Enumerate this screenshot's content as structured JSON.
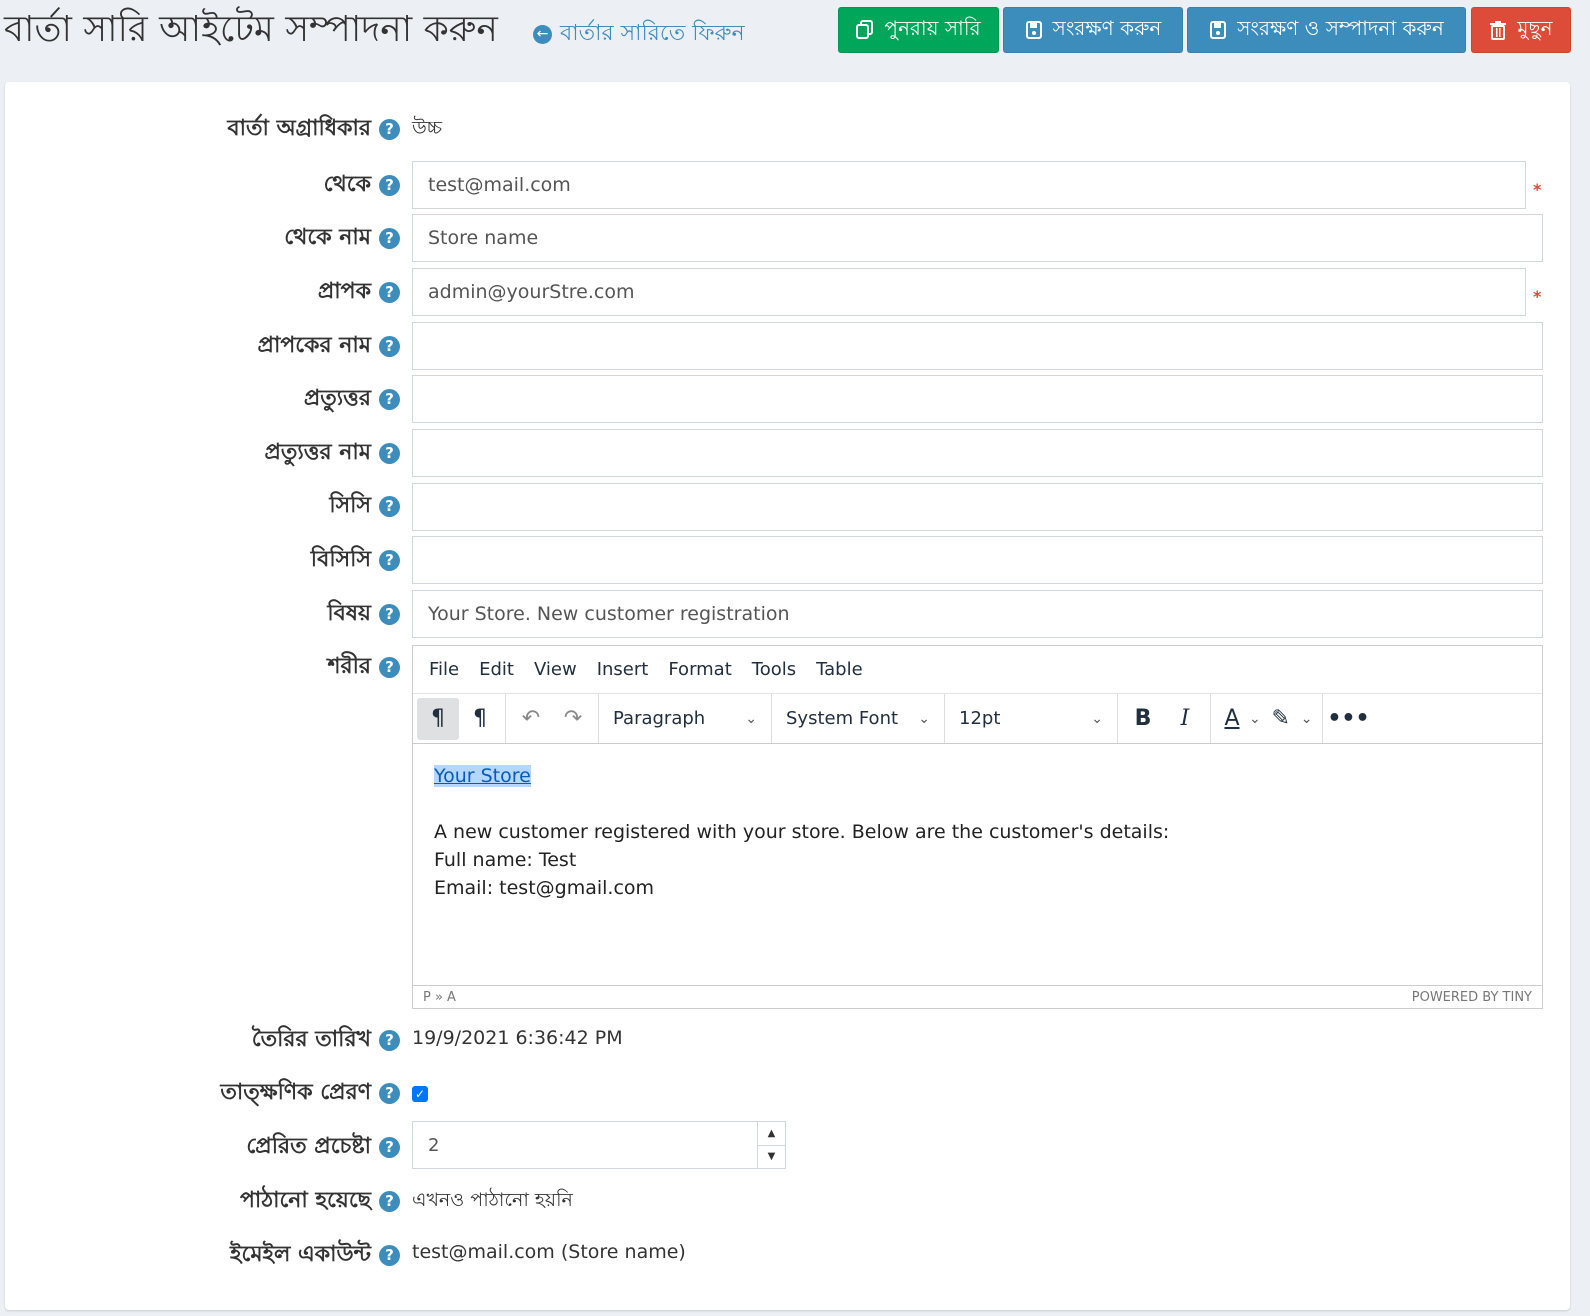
{
  "header": {
    "title": "বার্তা সারি আইটেম সম্পাদনা করুন",
    "back_icon": "arrow-left-circle-icon",
    "back_link": "বার্তার সারিতে ফিরুন",
    "buttons": {
      "requeue": "পুনরায় সারি",
      "save": "সংরক্ষণ করুন",
      "save_continue": "সংরক্ষণ ও সম্পাদনা করুন",
      "delete": "মুছুন"
    }
  },
  "help_glyph": "?",
  "required_mark": "*",
  "fields": {
    "priority": {
      "label": "বার্তা অগ্রাধিকার",
      "value": "উচ্চ"
    },
    "from": {
      "label": "থেকে",
      "value": "test@mail.com"
    },
    "from_name": {
      "label": "থেকে নাম",
      "value": "Store name"
    },
    "to": {
      "label": "প্রাপক",
      "value": "admin@yourStre.com"
    },
    "to_name": {
      "label": "প্রাপকের নাম",
      "value": ""
    },
    "reply_to": {
      "label": "প্রত্যুত্তর",
      "value": ""
    },
    "reply_to_name": {
      "label": "প্রত্যুত্তর নাম",
      "value": ""
    },
    "cc": {
      "label": "সিসি",
      "value": ""
    },
    "bcc": {
      "label": "বিসিসি",
      "value": ""
    },
    "subject": {
      "label": "বিষয়",
      "value": "Your Store. New customer registration"
    },
    "body": {
      "label": "শরীর"
    },
    "created_on": {
      "label": "তৈরির তারিখ",
      "value": "19/9/2021 6:36:42 PM"
    },
    "send_immediately": {
      "label": "তাত্ক্ষণিক প্রেরণ",
      "checked": true
    },
    "sent_tries": {
      "label": "প্রেরিত প্রচেষ্টা",
      "value": "2"
    },
    "sent_on": {
      "label": "পাঠানো হয়েছে",
      "value": "এখনও পাঠানো হয়নি"
    },
    "email_account": {
      "label": "ইমেইল একাউন্ট",
      "value": "test@mail.com (Store name)"
    }
  },
  "editor": {
    "menu": [
      "File",
      "Edit",
      "View",
      "Insert",
      "Format",
      "Tools",
      "Table"
    ],
    "block_format": "Paragraph",
    "font_family": "System Font",
    "font_size": "12pt",
    "content": {
      "link": "Your Store",
      "lines": [
        "A new customer registered with your store. Below are the customer's details:",
        "Full name: Test",
        "Email: test@gmail.com"
      ]
    },
    "status_path": "P » A",
    "powered_by": "POWERED BY TINY"
  },
  "colors": {
    "green": "#00a65a",
    "blue": "#3c8dbc",
    "red": "#dd4b39",
    "background": "#ecf0f5"
  }
}
